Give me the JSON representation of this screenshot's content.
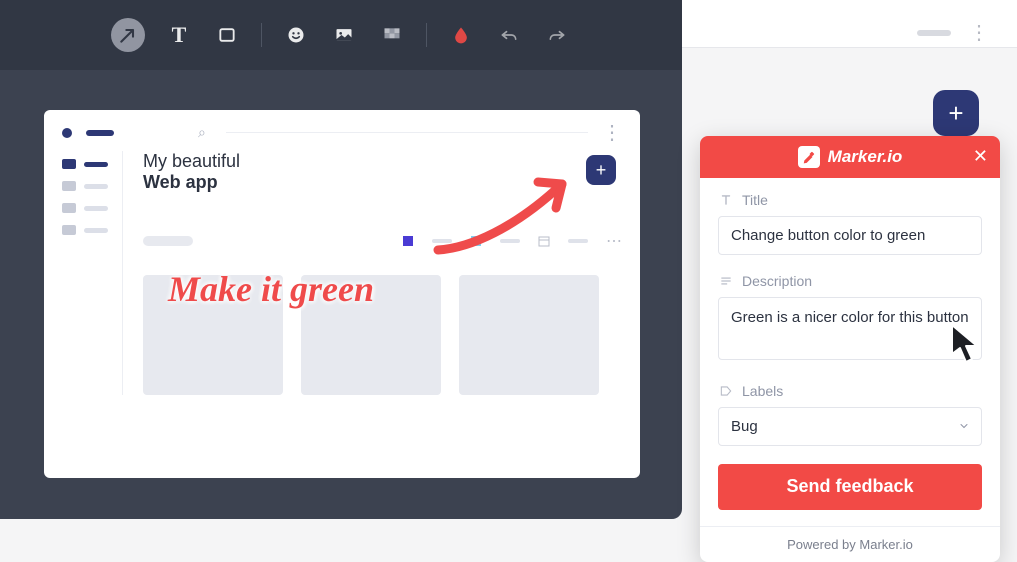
{
  "toolbar": {
    "arrow_tool": "arrow",
    "text_tool": "T",
    "rect_tool": "rectangle",
    "emoji_tool": "emoji",
    "image_tool": "image",
    "blur_tool": "blur",
    "color_tool": "color",
    "undo": "undo",
    "redo": "redo",
    "active_color": "#f24a46"
  },
  "canvas_app": {
    "search_glyph": "⌕",
    "title_line1": "My beautiful",
    "title_line2": "Web app",
    "plus_glyph": "+"
  },
  "annotation": {
    "text": "Make it green"
  },
  "background": {
    "fab_glyph": "+"
  },
  "panel": {
    "brand": "Marker.io",
    "close_glyph": "✕",
    "title_label": "Title",
    "title_value": "Change button color to green",
    "description_label": "Description",
    "description_value": "Green is a nicer color for this button",
    "labels_label": "Labels",
    "labels_value": "Bug",
    "send_label": "Send feedback",
    "footer": "Powered by Marker.io"
  }
}
